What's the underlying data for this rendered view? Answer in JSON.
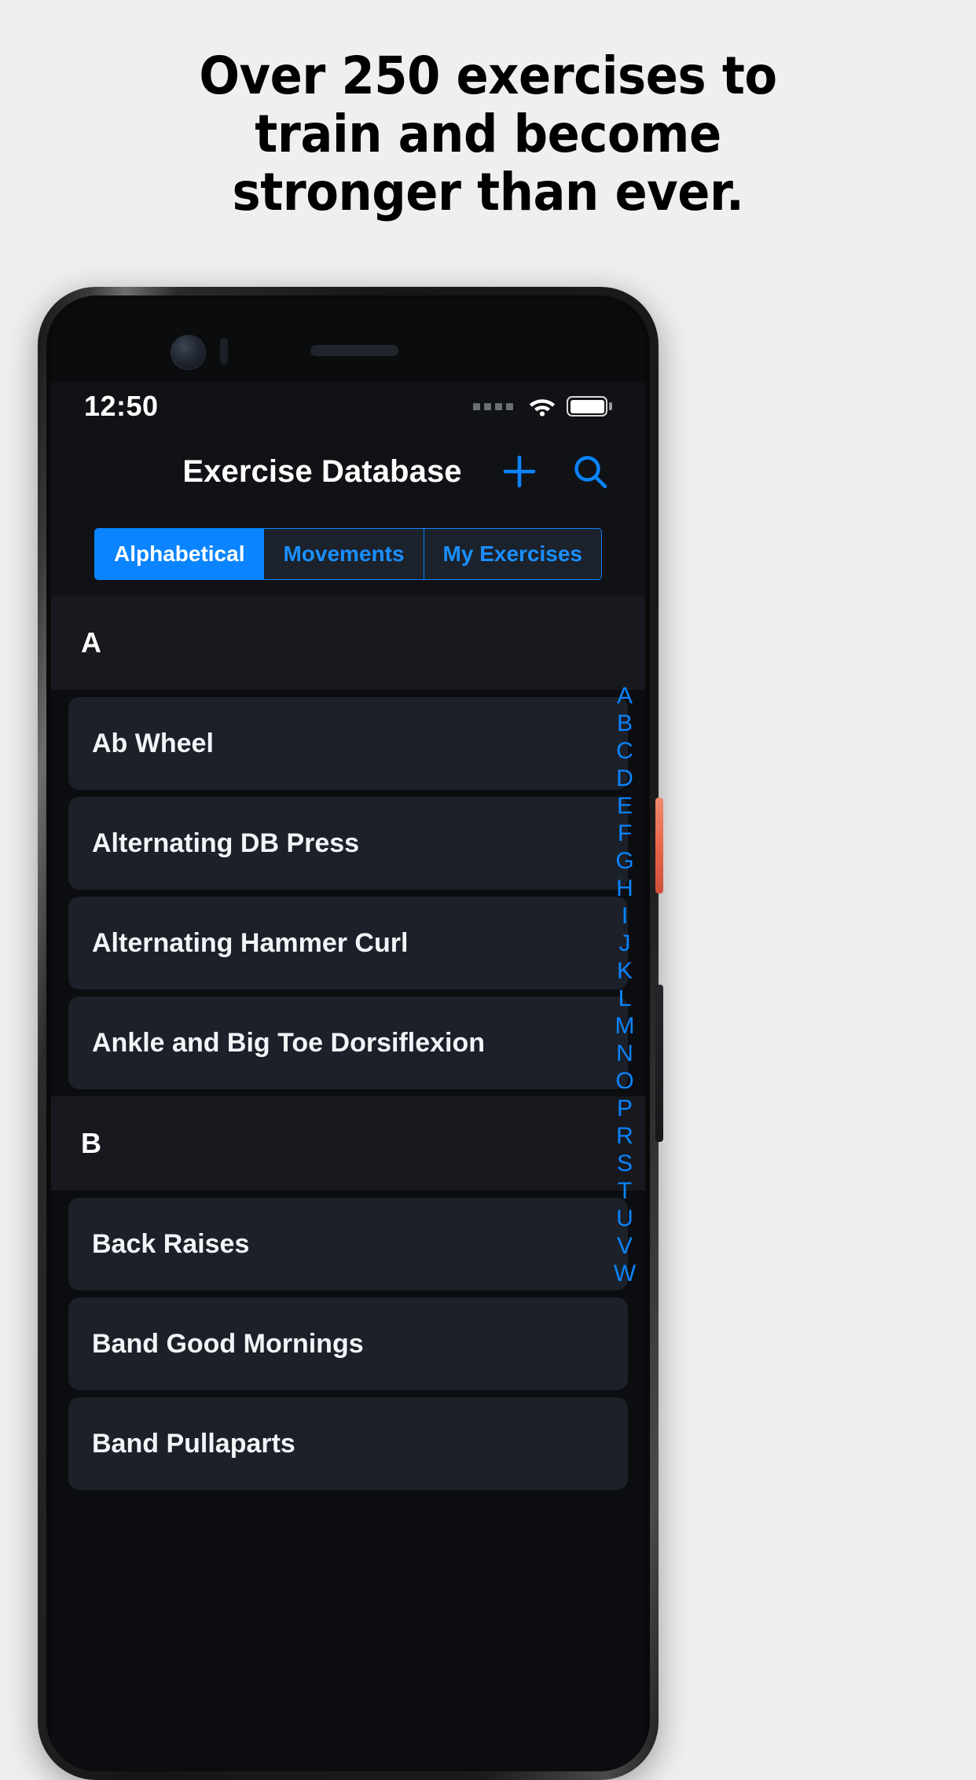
{
  "marketing": {
    "headline_lines": [
      "Over 250 exercises to",
      "train and become",
      "stronger than ever."
    ]
  },
  "colors": {
    "page_background": "#efefef",
    "accent_blue": "#0a84ff",
    "screen_background": "#0b0d10",
    "row_background": "#1c2029",
    "section_header_background": "#17191e",
    "power_button": "#e8664a"
  },
  "phone": {
    "status_bar": {
      "time": "12:50",
      "signal_icon": "signal-dots-icon",
      "wifi_icon": "wifi-icon",
      "battery_icon": "battery-full-icon"
    },
    "nav_bar": {
      "title": "Exercise Database",
      "add_icon": "plus-icon",
      "search_icon": "search-icon"
    },
    "segmented_control": {
      "selected": "Alphabetical",
      "options": [
        {
          "label": "Alphabetical",
          "selected": true
        },
        {
          "label": "Movements",
          "selected": false
        },
        {
          "label": "My Exercises",
          "selected": false
        }
      ]
    },
    "list": {
      "sections": [
        {
          "header": "A",
          "items": [
            "Ab Wheel",
            "Alternating DB Press",
            "Alternating Hammer Curl",
            "Ankle and Big Toe Dorsiflexion"
          ]
        },
        {
          "header": "B",
          "items": [
            "Back Raises",
            "Band Good Mornings",
            "Band Pullaparts"
          ]
        }
      ]
    },
    "alphabet_index": [
      "A",
      "B",
      "C",
      "D",
      "E",
      "F",
      "G",
      "H",
      "I",
      "J",
      "K",
      "L",
      "M",
      "N",
      "O",
      "P",
      "R",
      "S",
      "T",
      "U",
      "V",
      "W"
    ]
  }
}
